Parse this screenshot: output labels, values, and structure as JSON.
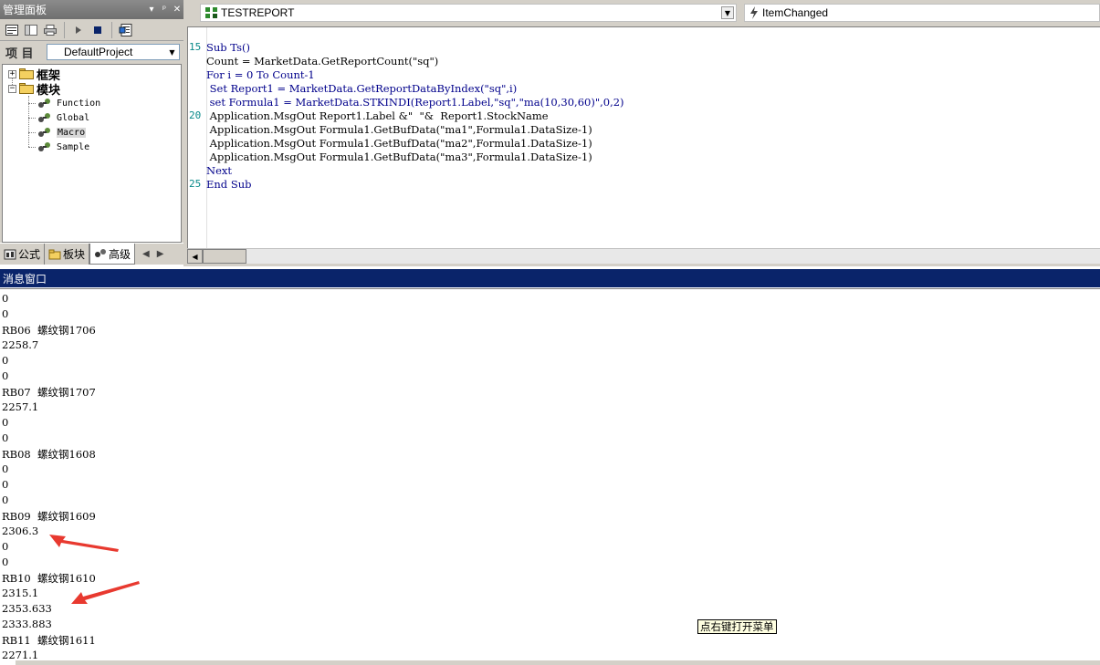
{
  "panel": {
    "title": "管理面板",
    "title_controls": [
      "▾",
      "ᵖ",
      "✕"
    ],
    "project_label": "项 目",
    "project_value": "DefaultProject",
    "tree": {
      "groups": [
        {
          "label": "框架",
          "expander": "+"
        },
        {
          "label": "模块",
          "expander": "−"
        }
      ],
      "modules": [
        "Function",
        "Global",
        "Macro",
        "Sample"
      ]
    },
    "tabs": [
      {
        "label": "公式",
        "icon": "formula-icon"
      },
      {
        "label": "板块",
        "icon": "folder-icon"
      },
      {
        "label": "高级",
        "icon": "advanced-icon"
      }
    ]
  },
  "editor": {
    "object_combo": "TESTREPORT",
    "event_combo": "ItemChanged",
    "line_numbers": [
      "15",
      "20",
      "25"
    ],
    "code_lines": [
      "Sub Ts()",
      "Count = MarketData.GetReportCount(\"sq\")",
      "For i = 0 To Count-1",
      " Set Report1 = MarketData.GetReportDataByIndex(\"sq\",i)",
      " set Formula1 = MarketData.STKINDI(Report1.Label,\"sq\",\"ma(10,30,60)\",0,2)",
      " Application.MsgOut Report1.Label &\"  \"&  Report1.StockName",
      " Application.MsgOut Formula1.GetBufData(\"ma1\",Formula1.DataSize-1)",
      " Application.MsgOut Formula1.GetBufData(\"ma2\",Formula1.DataSize-1)",
      " Application.MsgOut Formula1.GetBufData(\"ma3\",Formula1.DataSize-1)",
      "Next",
      "End Sub"
    ]
  },
  "message_window": {
    "title": "消息窗口",
    "lines": [
      "0",
      "0",
      "RB06  螺纹钢1706",
      "2258.7",
      "0",
      "0",
      "RB07  螺纹钢1707",
      "2257.1",
      "0",
      "0",
      "RB08  螺纹钢1608",
      "0",
      "0",
      "0",
      "RB09  螺纹钢1609",
      "2306.3",
      "0",
      "0",
      "RB10  螺纹钢1610",
      "2315.1",
      "2353.633",
      "2333.883",
      "RB11  螺纹钢1611",
      "2271.1"
    ],
    "tooltip": "点右键打开菜单"
  },
  "colors": {
    "panel_bg": "#d4d0c8",
    "msg_title_bg": "#0a246a",
    "keyword": "#00008b",
    "line_number": "#0a8a8a",
    "annotation_arrow": "#e8392f"
  }
}
